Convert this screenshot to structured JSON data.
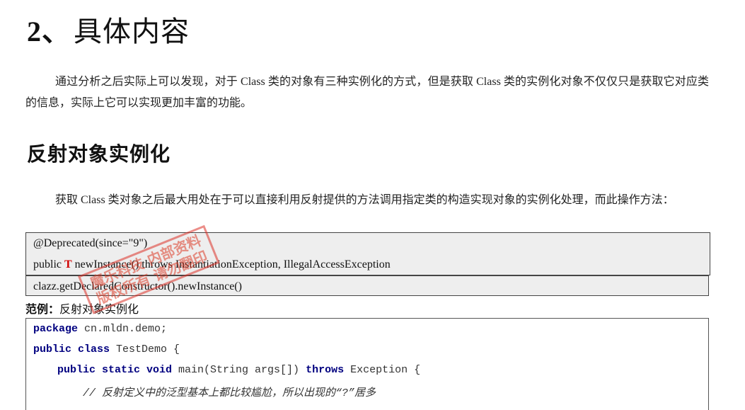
{
  "section": {
    "number": "2、",
    "title": "具体内容"
  },
  "intro": "通过分析之后实际上可以发现，对于 Class 类的对象有三种实例化的方式，但是获取 Class 类的实例化对象不仅仅只是获取它对应类的信息，实际上它可以实现更加丰富的功能。",
  "subsection": {
    "title": "反射对象实例化",
    "paragraph": "获取 Class 类对象之后最大用处在于可以直接利用反射提供的方法调用指定类的构造实现对象的实例化处理，而此操作方法："
  },
  "signature": {
    "annotation": "@Deprecated(since=\"9\")",
    "line_prefix": "public ",
    "generic_type": "T",
    "line_suffix": " newInstance() throws InstantiationException, IllegalAccessException"
  },
  "replacement_call": "clazz.getDeclaredConstructor().newInstance()",
  "example": {
    "label_bold": "范例：",
    "label_text": "反射对象实例化"
  },
  "code": {
    "line1_kw": "package",
    "line1_rest": " cn.mldn.demo;",
    "line2_kw": "public class",
    "line2_rest": " TestDemo {",
    "line3_kw1": "public static void",
    "line3_mid": " main(String args[]) ",
    "line3_kw2": "throws",
    "line3_rest": " Exception {",
    "line4_comment": "// 反射定义中的泛型基本上都比较尴尬，所以出现的“?”居多"
  },
  "watermark": {
    "line1": "魔乐科技 内部资料",
    "line2": "版权所有 请勿翻印"
  }
}
